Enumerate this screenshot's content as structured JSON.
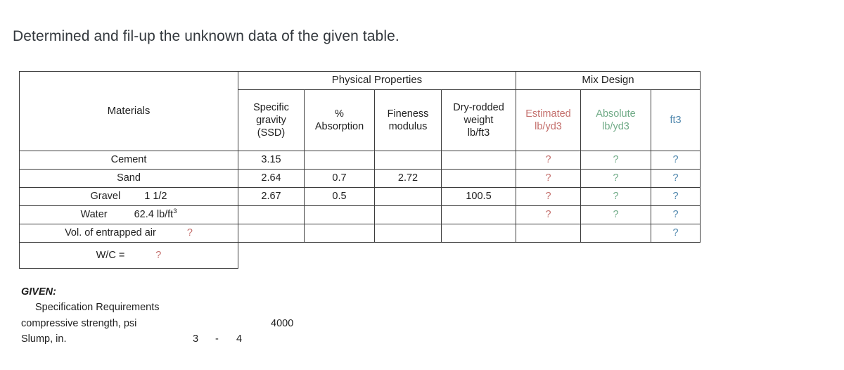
{
  "heading": "Determined and fil-up the unknown data of the given table.",
  "table": {
    "group_headers": {
      "materials": "Materials",
      "physical_properties": "Physical Properties",
      "mix_design": "Mix Design"
    },
    "sub_headers": {
      "specific_gravity": "Specific gravity (SSD)",
      "specific_gravity_l1": "Specific",
      "specific_gravity_l2": "gravity",
      "specific_gravity_l3": "(SSD)",
      "absorption_l1": "%",
      "absorption_l2": "Absorption",
      "fineness_l1": "Fineness",
      "fineness_l2": "modulus",
      "dry_rodded_l1": "Dry-rodded",
      "dry_rodded_l2": "weight",
      "dry_rodded_l3": "lb/ft3",
      "estimated_l1": "Estimated",
      "estimated_l2": "lb/yd3",
      "absolute_l1": "Absolute",
      "absolute_l2": "lb/yd3",
      "ft3": "ft3"
    },
    "colors": {
      "estimated": "#c4706d",
      "absolute": "#70ab87",
      "ft3": "#4f87ad",
      "unknown_red": "#c4706d",
      "border": "#3c3c3c"
    },
    "rows": [
      {
        "material": "Cement",
        "material_extra": "",
        "specific_gravity": "3.15",
        "absorption": "",
        "fineness_modulus": "",
        "dry_rodded_weight": "",
        "estimated": "?",
        "absolute": "?",
        "ft3": "?"
      },
      {
        "material": "Sand",
        "material_extra": "",
        "specific_gravity": "2.64",
        "absorption": "0.7",
        "fineness_modulus": "2.72",
        "dry_rodded_weight": "",
        "estimated": "?",
        "absolute": "?",
        "ft3": "?"
      },
      {
        "material": "Gravel",
        "material_extra": "1 1/2",
        "specific_gravity": "2.67",
        "absorption": "0.5",
        "fineness_modulus": "",
        "dry_rodded_weight": "100.5",
        "estimated": "?",
        "absolute": "?",
        "ft3": "?"
      },
      {
        "material": "Water",
        "material_extra": "62.4  lb/ft",
        "material_extra_sup": "3",
        "specific_gravity": "",
        "absorption": "",
        "fineness_modulus": "",
        "dry_rodded_weight": "",
        "estimated": "?",
        "absolute": "?",
        "ft3": "?"
      },
      {
        "material": "Vol. of entrapped air",
        "material_extra": "?",
        "specific_gravity": "",
        "absorption": "",
        "fineness_modulus": "",
        "dry_rodded_weight": "",
        "estimated": "",
        "absolute": "",
        "ft3": "?"
      }
    ],
    "wc_row": {
      "label": "W/C =",
      "value": "?"
    }
  },
  "given": {
    "title": "GIVEN:",
    "spec_requirements": "Specification Requirements",
    "compressive_label": "compressive strength, psi",
    "compressive_value": "4000",
    "slump_label": "Slump, in.",
    "slump_min": "3",
    "slump_dash": "-",
    "slump_max": "4"
  }
}
